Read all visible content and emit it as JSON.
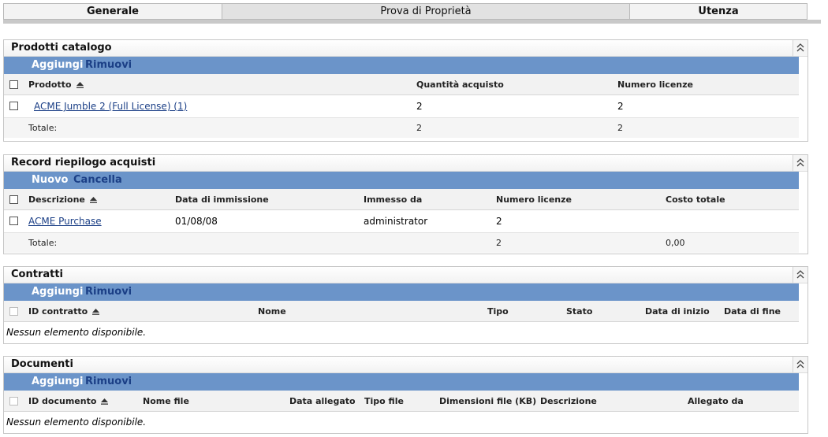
{
  "tabs": [
    {
      "label": "Generale"
    },
    {
      "label": "Prova di Proprietà"
    },
    {
      "label": "Utenza"
    }
  ],
  "catalog": {
    "title": "Prodotti catalogo",
    "actions": {
      "add": "Aggiungi",
      "remove": "Rimuovi"
    },
    "columns": {
      "product": "Prodotto",
      "qty": "Quantità acquisto",
      "licenses": "Numero licenze"
    },
    "rows": [
      {
        "product": "ACME Jumble 2 (Full License) (1)",
        "qty": "2",
        "licenses": "2"
      }
    ],
    "total": {
      "label": "Totale:",
      "qty": "2",
      "licenses": "2"
    }
  },
  "purchases": {
    "title": "Record riepilogo acquisti",
    "actions": {
      "new": "Nuovo",
      "delete": "Cancella"
    },
    "columns": {
      "description": "Descrizione",
      "entry_date": "Data di immissione",
      "entered_by": "Immesso da",
      "licenses": "Numero licenze",
      "total_cost": "Costo totale"
    },
    "rows": [
      {
        "description": "ACME Purchase",
        "entry_date": "01/08/08",
        "entered_by": "administrator",
        "licenses": "2",
        "total_cost": ""
      }
    ],
    "total": {
      "label": "Totale:",
      "licenses": "2",
      "total_cost": "0,00"
    }
  },
  "contracts": {
    "title": "Contratti",
    "actions": {
      "add": "Aggiungi",
      "remove": "Rimuovi"
    },
    "columns": {
      "id": "ID contratto",
      "name": "Nome",
      "type": "Tipo",
      "state": "Stato",
      "start": "Data di inizio",
      "end": "Data di fine"
    },
    "empty": "Nessun elemento disponibile."
  },
  "documents": {
    "title": "Documenti",
    "actions": {
      "add": "Aggiungi",
      "remove": "Rimuovi"
    },
    "columns": {
      "id": "ID documento",
      "file_name": "Nome file",
      "attach_date": "Data allegato",
      "file_type": "Tipo file",
      "size": "Dimensioni file (KB)",
      "description": "Descrizione",
      "attached_by": "Allegato da"
    },
    "empty": "Nessun elemento disponibile."
  },
  "icons": {
    "collapse": "double-chevron-up-icon",
    "sort": "sort-ascending-icon"
  },
  "colors": {
    "toolbar": "#6b94c9",
    "link": "#1b3f86"
  }
}
